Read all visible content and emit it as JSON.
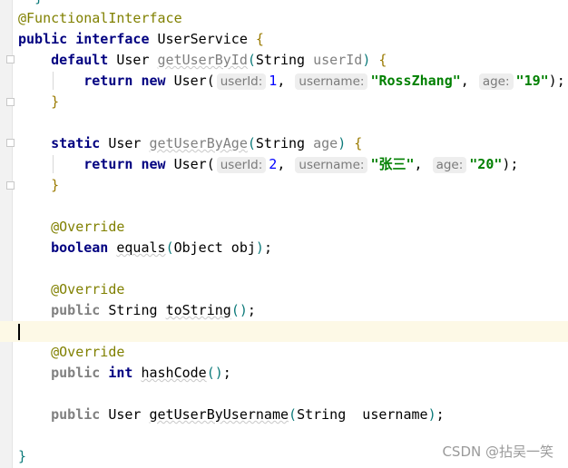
{
  "editor": {
    "lines": [
      {
        "tokens": [
          {
            "t": "  ",
            "c": ""
          },
          {
            "t": "}",
            "c": "brace"
          }
        ]
      },
      {
        "tokens": [
          {
            "t": "@FunctionalInterface",
            "c": "ann"
          }
        ]
      },
      {
        "tokens": [
          {
            "t": "public",
            "c": "kw"
          },
          {
            "t": " ",
            "c": ""
          },
          {
            "t": "interface",
            "c": "kw"
          },
          {
            "t": " UserService ",
            "c": ""
          },
          {
            "t": "{",
            "c": "brace2"
          }
        ]
      },
      {
        "tokens": [
          {
            "t": "    ",
            "c": ""
          },
          {
            "t": "default",
            "c": "kw"
          },
          {
            "t": " User ",
            "c": ""
          },
          {
            "t": "getUserById",
            "c": "unused"
          },
          {
            "t": "(",
            "c": "brace"
          },
          {
            "t": "String ",
            "c": ""
          },
          {
            "t": "userId",
            "c": "param"
          },
          {
            "t": ")",
            "c": "brace"
          },
          {
            "t": " ",
            "c": ""
          },
          {
            "t": "{",
            "c": "brace2"
          }
        ]
      },
      {
        "tokens": [
          {
            "t": "        ",
            "c": ""
          },
          {
            "t": "return",
            "c": "kw"
          },
          {
            "t": " ",
            "c": ""
          },
          {
            "t": "new",
            "c": "kw"
          },
          {
            "t": " User(",
            "c": ""
          },
          {
            "t": "userId:",
            "c": "hint"
          },
          {
            "t": "1",
            "c": "num"
          },
          {
            "t": ", ",
            "c": ""
          },
          {
            "t": "username:",
            "c": "hint"
          },
          {
            "t": "\"RossZhang\"",
            "c": "str"
          },
          {
            "t": ", ",
            "c": ""
          },
          {
            "t": "age:",
            "c": "hint"
          },
          {
            "t": "\"19\"",
            "c": "str"
          },
          {
            "t": ");",
            "c": ""
          }
        ]
      },
      {
        "tokens": [
          {
            "t": "    ",
            "c": ""
          },
          {
            "t": "}",
            "c": "brace2"
          }
        ]
      },
      {
        "tokens": []
      },
      {
        "tokens": [
          {
            "t": "    ",
            "c": ""
          },
          {
            "t": "static",
            "c": "kw"
          },
          {
            "t": " User ",
            "c": ""
          },
          {
            "t": "getUserByAge",
            "c": "unused"
          },
          {
            "t": "(",
            "c": "brace"
          },
          {
            "t": "String ",
            "c": ""
          },
          {
            "t": "age",
            "c": "param"
          },
          {
            "t": ")",
            "c": "brace"
          },
          {
            "t": " ",
            "c": ""
          },
          {
            "t": "{",
            "c": "brace2"
          }
        ]
      },
      {
        "tokens": [
          {
            "t": "        ",
            "c": ""
          },
          {
            "t": "return",
            "c": "kw"
          },
          {
            "t": " ",
            "c": ""
          },
          {
            "t": "new",
            "c": "kw"
          },
          {
            "t": " User(",
            "c": ""
          },
          {
            "t": "userId:",
            "c": "hint"
          },
          {
            "t": "2",
            "c": "num"
          },
          {
            "t": ", ",
            "c": ""
          },
          {
            "t": "username:",
            "c": "hint"
          },
          {
            "t": "\"张三\"",
            "c": "str"
          },
          {
            "t": ", ",
            "c": ""
          },
          {
            "t": "age:",
            "c": "hint"
          },
          {
            "t": "\"20\"",
            "c": "str"
          },
          {
            "t": ");",
            "c": ""
          }
        ]
      },
      {
        "tokens": [
          {
            "t": "    ",
            "c": ""
          },
          {
            "t": "}",
            "c": "brace2"
          }
        ]
      },
      {
        "tokens": []
      },
      {
        "tokens": [
          {
            "t": "    ",
            "c": ""
          },
          {
            "t": "@Override",
            "c": "ann"
          }
        ]
      },
      {
        "tokens": [
          {
            "t": "    ",
            "c": ""
          },
          {
            "t": "boolean",
            "c": "kw"
          },
          {
            "t": " ",
            "c": ""
          },
          {
            "t": "equals",
            "c": "meth"
          },
          {
            "t": "(",
            "c": "brace"
          },
          {
            "t": "Object obj",
            "c": ""
          },
          {
            "t": ")",
            "c": "brace"
          },
          {
            "t": ";",
            "c": ""
          }
        ]
      },
      {
        "tokens": []
      },
      {
        "tokens": [
          {
            "t": "    ",
            "c": ""
          },
          {
            "t": "@Override",
            "c": "ann"
          }
        ]
      },
      {
        "tokens": [
          {
            "t": "    ",
            "c": ""
          },
          {
            "t": "public",
            "c": "kwg"
          },
          {
            "t": " String ",
            "c": ""
          },
          {
            "t": "toString",
            "c": "meth"
          },
          {
            "t": "()",
            "c": "brace"
          },
          {
            "t": ";",
            "c": ""
          }
        ]
      },
      {
        "tokens": [],
        "current": true
      },
      {
        "tokens": [
          {
            "t": "    ",
            "c": ""
          },
          {
            "t": "@Override",
            "c": "ann"
          }
        ]
      },
      {
        "tokens": [
          {
            "t": "    ",
            "c": ""
          },
          {
            "t": "public",
            "c": "kwg"
          },
          {
            "t": " ",
            "c": ""
          },
          {
            "t": "int",
            "c": "kw"
          },
          {
            "t": " ",
            "c": ""
          },
          {
            "t": "hashCode",
            "c": "meth"
          },
          {
            "t": "()",
            "c": "brace"
          },
          {
            "t": ";",
            "c": ""
          }
        ]
      },
      {
        "tokens": []
      },
      {
        "tokens": [
          {
            "t": "    ",
            "c": ""
          },
          {
            "t": "public",
            "c": "kwg"
          },
          {
            "t": " User ",
            "c": ""
          },
          {
            "t": "getUserByUsername",
            "c": "meth"
          },
          {
            "t": "(",
            "c": "brace"
          },
          {
            "t": "String  username",
            "c": ""
          },
          {
            "t": ")",
            "c": "brace"
          },
          {
            "t": ";",
            "c": ""
          }
        ]
      },
      {
        "tokens": []
      },
      {
        "tokens": [
          {
            "t": "}",
            "c": "brace"
          }
        ]
      }
    ]
  },
  "watermark": "CSDN @拈吴一笑"
}
